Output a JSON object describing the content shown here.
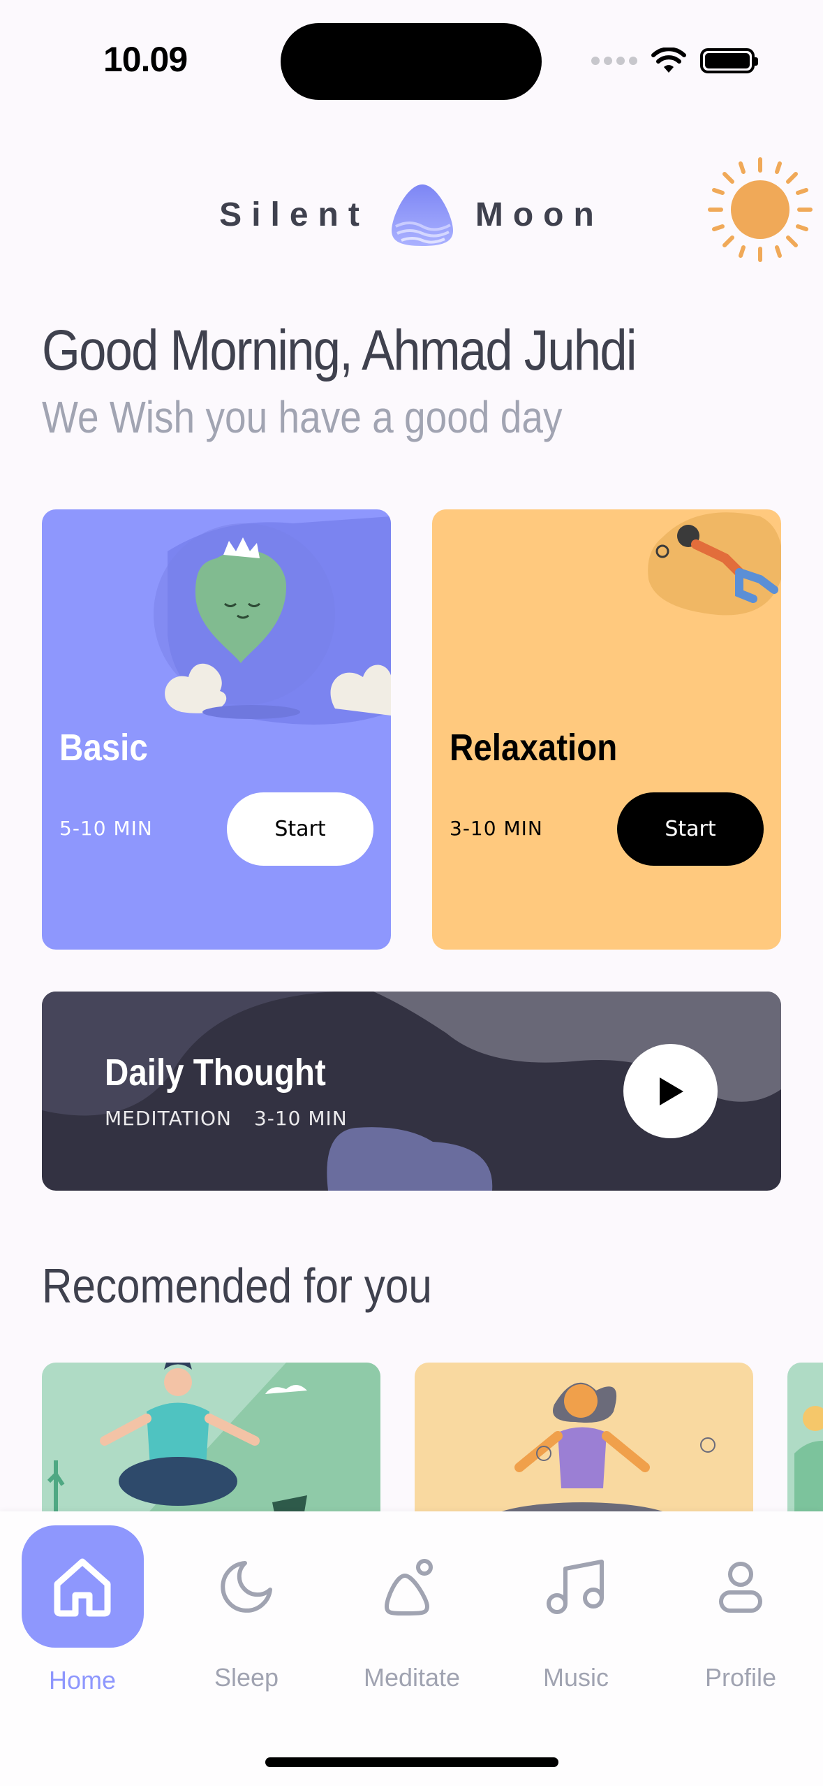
{
  "status_bar": {
    "time": "10.09"
  },
  "header": {
    "logo_left": "Silent",
    "logo_right": "Moon"
  },
  "greeting": {
    "title": "Good Morning, Ahmad Juhdi",
    "subtitle": "We Wish you have a good day"
  },
  "cards": [
    {
      "title": "Basic",
      "duration": "5-10 MIN",
      "button": "Start",
      "color": "#8e97fd"
    },
    {
      "title": "Relaxation",
      "duration": "3-10 MIN",
      "button": "Start",
      "color": "#ffc97e"
    }
  ],
  "daily_thought": {
    "title": "Daily Thought",
    "category": "MEDITATION",
    "duration": "3-10 MIN"
  },
  "recommended": {
    "title": "Recomended for you"
  },
  "tabbar": {
    "items": [
      {
        "label": "Home",
        "icon": "home-icon",
        "active": true
      },
      {
        "label": "Sleep",
        "icon": "moon-icon",
        "active": false
      },
      {
        "label": "Meditate",
        "icon": "meditate-icon",
        "active": false
      },
      {
        "label": "Music",
        "icon": "music-icon",
        "active": false
      },
      {
        "label": "Profile",
        "icon": "profile-icon",
        "active": false
      }
    ]
  },
  "colors": {
    "accent": "#8e97fd",
    "text": "#3f414e",
    "muted": "#a1a4b2",
    "dark_card": "#333242"
  }
}
